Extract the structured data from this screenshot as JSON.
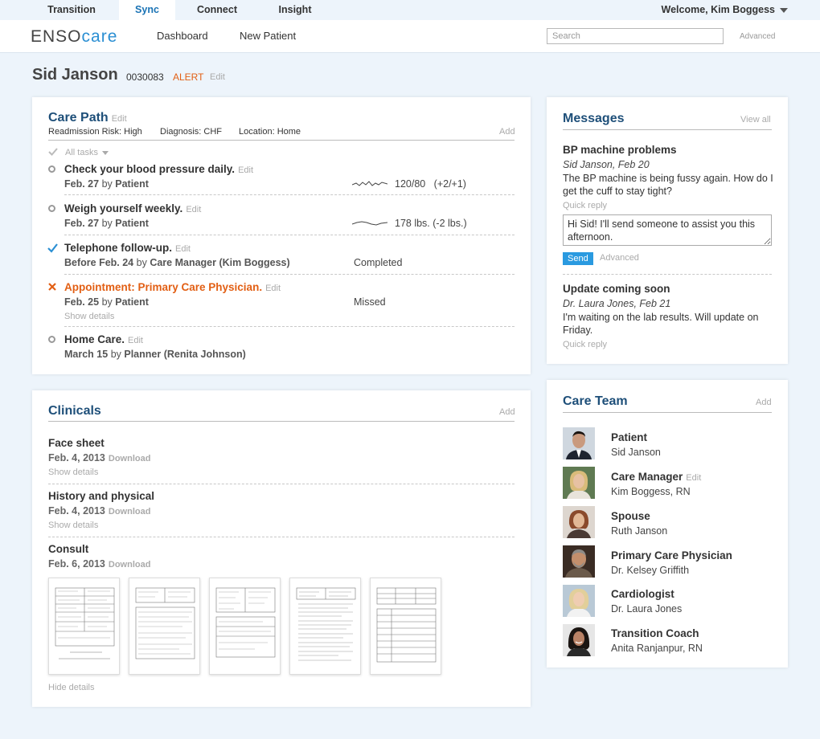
{
  "tabs": [
    "Transition",
    "Sync",
    "Connect",
    "Insight"
  ],
  "welcome": "Welcome, Kim Boggess",
  "logo": {
    "part1": "ENSO",
    "part2": "care"
  },
  "nav": {
    "dashboard": "Dashboard",
    "new_patient": "New Patient"
  },
  "search": {
    "placeholder": "Search",
    "advanced": "Advanced"
  },
  "patient": {
    "name": "Sid Janson",
    "id": "0030083",
    "alert": "ALERT",
    "edit": "Edit"
  },
  "care_path": {
    "title": "Care Path",
    "edit": "Edit",
    "add": "Add",
    "risk": "Readmission Risk: High",
    "diagnosis": "Diagnosis: CHF",
    "location": "Location: Home",
    "filter": "All tasks",
    "tasks": [
      {
        "title": "Check your blood pressure daily.",
        "edit": "Edit",
        "date": "Feb. 27",
        "by": "by",
        "who": "Patient",
        "value": "120/80   (+2/+1)",
        "status": "open"
      },
      {
        "title": "Weigh yourself weekly.",
        "edit": "Edit",
        "date": "Feb. 27",
        "by": "by",
        "who": "Patient",
        "value": "178 lbs. (-2 lbs.)",
        "status": "open"
      },
      {
        "title": "Telephone follow-up.",
        "edit": "Edit",
        "date": "Before Feb. 24",
        "by": "by",
        "who": "Care Manager (Kim Boggess)",
        "value": "Completed",
        "status": "done"
      },
      {
        "title": "Appointment: Primary Care Physician.",
        "edit": "Edit",
        "date": "Feb. 25",
        "by": "by",
        "who": "Patient",
        "value": "Missed",
        "status": "missed",
        "details": "Show details"
      },
      {
        "title": "Home Care.",
        "edit": "Edit",
        "date": "March 15",
        "by": "by",
        "who": "Planner (Renita Johnson)",
        "value": "",
        "status": "open"
      }
    ]
  },
  "clinicals": {
    "title": "Clinicals",
    "add": "Add",
    "docs": [
      {
        "title": "Face sheet",
        "date": "Feb. 4, 2013",
        "download": "Download",
        "details": "Show details"
      },
      {
        "title": "History and physical",
        "date": "Feb. 4, 2013",
        "download": "Download",
        "details": "Show details"
      },
      {
        "title": "Consult",
        "date": "Feb. 6, 2013",
        "download": "Download",
        "details": "Hide details"
      }
    ]
  },
  "messages": {
    "title": "Messages",
    "view_all": "View all",
    "items": [
      {
        "title": "BP machine problems",
        "from": "Sid Janson, Feb 20",
        "body": "The BP machine is being fussy again. How do I get the cuff to stay tight?",
        "reply": "Quick reply"
      },
      {
        "title": "Update coming soon",
        "from": "Dr. Laura Jones, Feb 21",
        "body": "I'm waiting on the lab results. Will update on Friday.",
        "reply": "Quick reply"
      }
    ],
    "draft": "Hi Sid! I'll send someone to assist you this afternoon.",
    "send": "Send",
    "advanced": "Advanced"
  },
  "care_team": {
    "title": "Care Team",
    "add": "Add",
    "edit": "Edit",
    "members": [
      {
        "role": "Patient",
        "name": "Sid Janson"
      },
      {
        "role": "Care Manager",
        "name": "Kim Boggess, RN"
      },
      {
        "role": "Spouse",
        "name": "Ruth Janson"
      },
      {
        "role": "Primary Care Physician",
        "name": "Dr. Kelsey Griffith"
      },
      {
        "role": "Cardiologist",
        "name": "Dr. Laura Jones"
      },
      {
        "role": "Transition Coach",
        "name": "Anita Ranjanpur, RN"
      }
    ]
  },
  "colors": {
    "accent": "#2b8fd3",
    "title": "#1e4f79",
    "alert": "#e25f14",
    "background": "#edf4fb"
  }
}
